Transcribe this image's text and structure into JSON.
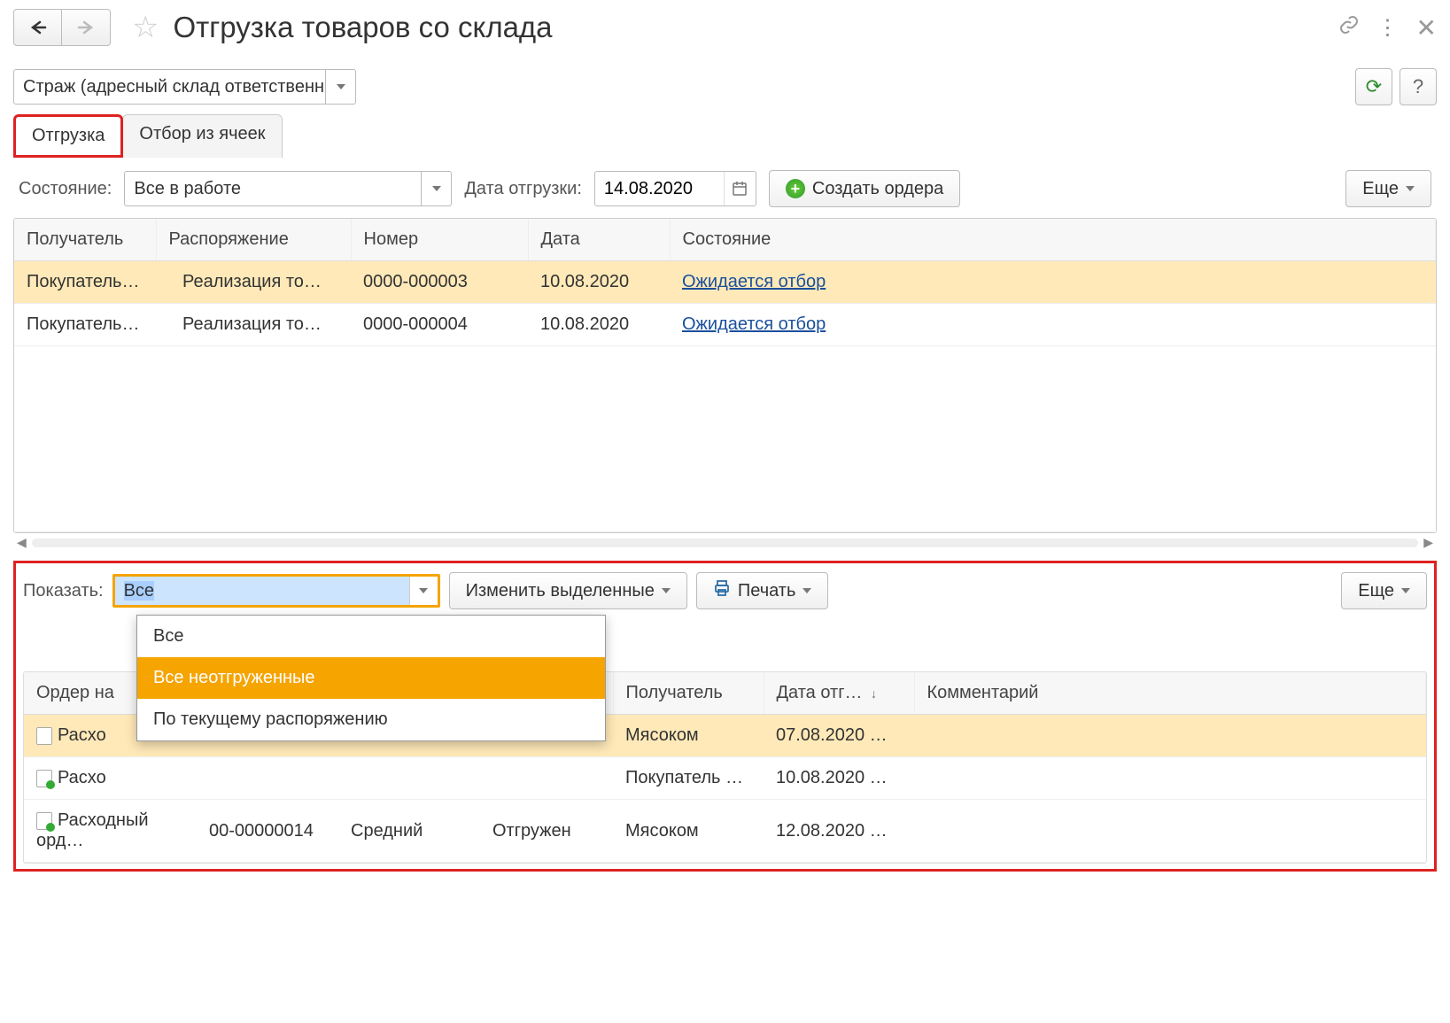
{
  "header": {
    "title": "Отгрузка товаров со склада"
  },
  "warehouse": {
    "value": "Страж (адресный склад ответственн"
  },
  "tabs": [
    {
      "label": "Отгрузка",
      "active": true
    },
    {
      "label": "Отбор из ячеек",
      "active": false
    }
  ],
  "filters": {
    "state_label": "Состояние:",
    "state_value": "Все в работе",
    "date_label": "Дата отгрузки:",
    "date_value": "14.08.2020",
    "create_orders_label": "Создать ордера",
    "more_label": "Еще"
  },
  "grid_top": {
    "columns": [
      "Получатель",
      "Распоряжение",
      "Номер",
      "Дата",
      "Состояние"
    ],
    "rows": [
      {
        "recipient": "Покупатель…",
        "order": "Реализация то…",
        "number": "0000-000003",
        "date": "10.08.2020",
        "state": "Ожидается отбор",
        "selected": true
      },
      {
        "recipient": "Покупатель…",
        "order": "Реализация то…",
        "number": "0000-000004",
        "date": "10.08.2020",
        "state": "Ожидается отбор",
        "selected": false
      }
    ]
  },
  "lower": {
    "show_label": "Показать:",
    "show_value": "Все",
    "change_selected_label": "Изменить выделенные",
    "print_label": "Печать",
    "more_label": "Еще",
    "dropdown": {
      "items": [
        "Все",
        "Все неотгруженные",
        "По текущему распоряжению"
      ],
      "hover_index": 1
    },
    "columns": [
      "Ордер на",
      "",
      "",
      "",
      "Получатель",
      "Дата отг…",
      "Комментарий"
    ],
    "col_sorted_label": "Дата отг…",
    "rows": [
      {
        "doc": "Расхо",
        "n": "",
        "p": "",
        "s": "",
        "recipient": "Мясоком",
        "date": "07.08.2020 …",
        "comment": "",
        "selected": true,
        "icon_ok": false
      },
      {
        "doc": "Расхо",
        "n": "",
        "p": "",
        "s": "",
        "recipient": "Покупатель …",
        "date": "10.08.2020 …",
        "comment": "",
        "selected": false,
        "icon_ok": true
      },
      {
        "doc": "Расходный орд…",
        "n": "00-00000014",
        "p": "Средний",
        "s": "Отгружен",
        "recipient": "Мясоком",
        "date": "12.08.2020 …",
        "comment": "",
        "selected": false,
        "icon_ok": true
      }
    ]
  }
}
